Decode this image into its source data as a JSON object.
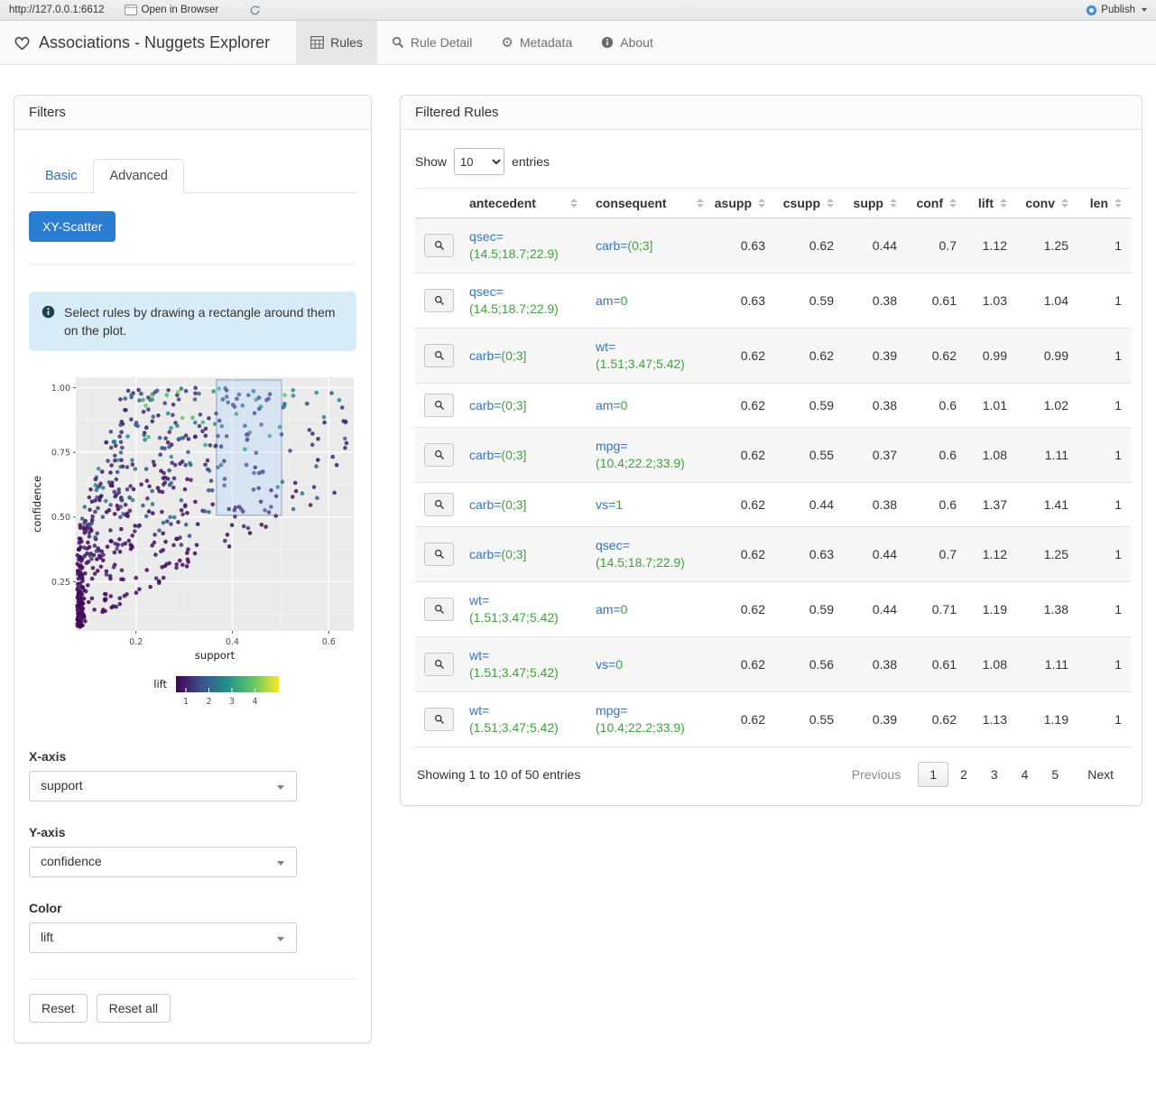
{
  "viewer_bar": {
    "url": "http://127.0.0.1:6612",
    "open_in_browser_label": "Open in Browser",
    "publish_label": "Publish"
  },
  "navbar": {
    "brand": "Associations - Nuggets Explorer",
    "tabs": [
      {
        "label": "Rules",
        "icon": "table-icon",
        "active": true
      },
      {
        "label": "Rule Detail",
        "icon": "search-icon",
        "active": false
      },
      {
        "label": "Metadata",
        "icon": "gear-icon",
        "active": false
      },
      {
        "label": "About",
        "icon": "info-icon",
        "active": false
      }
    ]
  },
  "filters": {
    "title": "Filters",
    "tabs": [
      {
        "label": "Basic",
        "active": false
      },
      {
        "label": "Advanced",
        "active": true
      }
    ],
    "scatter_button_label": "XY-Scatter",
    "info_alert": "Select rules by drawing a rectangle around them on the plot.",
    "x_axis": {
      "label": "X-axis",
      "value": "support"
    },
    "y_axis": {
      "label": "Y-axis",
      "value": "confidence"
    },
    "color": {
      "label": "Color",
      "value": "lift"
    },
    "reset_label": "Reset",
    "reset_all_label": "Reset all"
  },
  "chart_data": {
    "type": "scatter",
    "xlabel": "support",
    "ylabel": "confidence",
    "x_ticks": [
      0.2,
      0.4,
      0.6
    ],
    "x_minor_ticks": [
      0.1,
      0.3,
      0.5
    ],
    "y_ticks": [
      0.25,
      0.5,
      0.75,
      1.0
    ],
    "y_minor_ticks": [
      0.125,
      0.375,
      0.625,
      0.875
    ],
    "xlim": [
      0.075,
      0.652
    ],
    "ylim": [
      0.06,
      1.04
    ],
    "point_count": 620,
    "point_style": {
      "radius": 2.3,
      "opacity": 0.85
    },
    "color_scale": {
      "title": "lift",
      "palette": "viridis",
      "domain": [
        0.57,
        5.04
      ],
      "ticks": [
        1,
        2,
        3,
        4
      ]
    },
    "selection_rect": {
      "x0": 0.367,
      "x1": 0.502,
      "y0": 0.507,
      "y1": 1.03
    },
    "description": "Association rules plotted as support (x) vs confidence (y), colored by lift with viridis palette; dense dark cluster at support 0.08-0.35 across confidence 0.05-1.0, sparse diagonal lower bound where confidence = support, brush selection rectangle over support 0.37-0.50, confidence 0.51-1.0"
  },
  "rules_panel": {
    "title": "Filtered Rules",
    "show_label": "Show",
    "entries_label": "entries",
    "page_length": "10",
    "columns": [
      {
        "key": "antecedent",
        "label": "antecedent",
        "align": "left"
      },
      {
        "key": "consequent",
        "label": "consequent",
        "align": "left"
      },
      {
        "key": "asupp",
        "label": "asupp",
        "align": "right"
      },
      {
        "key": "csupp",
        "label": "csupp",
        "align": "right"
      },
      {
        "key": "supp",
        "label": "supp",
        "align": "right"
      },
      {
        "key": "conf",
        "label": "conf",
        "align": "right"
      },
      {
        "key": "lift",
        "label": "lift",
        "align": "right"
      },
      {
        "key": "conv",
        "label": "conv",
        "align": "right"
      },
      {
        "key": "len",
        "label": "len",
        "align": "right"
      }
    ],
    "rows": [
      {
        "antecedent": {
          "attr": "qsec=",
          "value": "(14.5;18.7;22.9)"
        },
        "consequent": {
          "attr": "carb=",
          "value": "(0;3]"
        },
        "asupp": "0.63",
        "csupp": "0.62",
        "supp": "0.44",
        "conf": "0.7",
        "lift": "1.12",
        "conv": "1.25",
        "len": "1"
      },
      {
        "antecedent": {
          "attr": "qsec=",
          "value": "(14.5;18.7;22.9)"
        },
        "consequent": {
          "attr": "am=",
          "value": "0"
        },
        "asupp": "0.63",
        "csupp": "0.59",
        "supp": "0.38",
        "conf": "0.61",
        "lift": "1.03",
        "conv": "1.04",
        "len": "1"
      },
      {
        "antecedent": {
          "attr": "carb=",
          "value": "(0;3]"
        },
        "consequent": {
          "attr": "wt=",
          "value": "(1.51;3.47;5.42)"
        },
        "asupp": "0.62",
        "csupp": "0.62",
        "supp": "0.39",
        "conf": "0.62",
        "lift": "0.99",
        "conv": "0.99",
        "len": "1"
      },
      {
        "antecedent": {
          "attr": "carb=",
          "value": "(0;3]"
        },
        "consequent": {
          "attr": "am=",
          "value": "0"
        },
        "asupp": "0.62",
        "csupp": "0.59",
        "supp": "0.38",
        "conf": "0.6",
        "lift": "1.01",
        "conv": "1.02",
        "len": "1"
      },
      {
        "antecedent": {
          "attr": "carb=",
          "value": "(0;3]"
        },
        "consequent": {
          "attr": "mpg=",
          "value": "(10.4;22.2;33.9)"
        },
        "asupp": "0.62",
        "csupp": "0.55",
        "supp": "0.37",
        "conf": "0.6",
        "lift": "1.08",
        "conv": "1.11",
        "len": "1"
      },
      {
        "antecedent": {
          "attr": "carb=",
          "value": "(0;3]"
        },
        "consequent": {
          "attr": "vs=",
          "value": "1"
        },
        "asupp": "0.62",
        "csupp": "0.44",
        "supp": "0.38",
        "conf": "0.6",
        "lift": "1.37",
        "conv": "1.41",
        "len": "1"
      },
      {
        "antecedent": {
          "attr": "carb=",
          "value": "(0;3]"
        },
        "consequent": {
          "attr": "qsec=",
          "value": "(14.5;18.7;22.9)"
        },
        "asupp": "0.62",
        "csupp": "0.63",
        "supp": "0.44",
        "conf": "0.7",
        "lift": "1.12",
        "conv": "1.25",
        "len": "1"
      },
      {
        "antecedent": {
          "attr": "wt=",
          "value": "(1.51;3.47;5.42)"
        },
        "consequent": {
          "attr": "am=",
          "value": "0"
        },
        "asupp": "0.62",
        "csupp": "0.59",
        "supp": "0.44",
        "conf": "0.71",
        "lift": "1.19",
        "conv": "1.38",
        "len": "1"
      },
      {
        "antecedent": {
          "attr": "wt=",
          "value": "(1.51;3.47;5.42)"
        },
        "consequent": {
          "attr": "vs=",
          "value": "0"
        },
        "asupp": "0.62",
        "csupp": "0.56",
        "supp": "0.38",
        "conf": "0.61",
        "lift": "1.08",
        "conv": "1.11",
        "len": "1"
      },
      {
        "antecedent": {
          "attr": "wt=",
          "value": "(1.51;3.47;5.42)"
        },
        "consequent": {
          "attr": "mpg=",
          "value": "(10.4;22.2;33.9)"
        },
        "asupp": "0.62",
        "csupp": "0.55",
        "supp": "0.39",
        "conf": "0.62",
        "lift": "1.13",
        "conv": "1.19",
        "len": "1"
      }
    ],
    "footer_info": "Showing 1 to 10 of 50 entries",
    "pagination": {
      "previous_label": "Previous",
      "pages": [
        "1",
        "2",
        "3",
        "4",
        "5"
      ],
      "current_page": "1",
      "next_label": "Next"
    }
  },
  "colors": {
    "primary": "#2b7dd2",
    "antecedent_attr_blue": "#3273c4",
    "value_green": "#3fa23c",
    "alert_bg": "#d8ecf7",
    "panel_bg": "#ebebeb",
    "viridis": [
      "#440154",
      "#3b528b",
      "#21918c",
      "#5ec962",
      "#fde725"
    ]
  }
}
